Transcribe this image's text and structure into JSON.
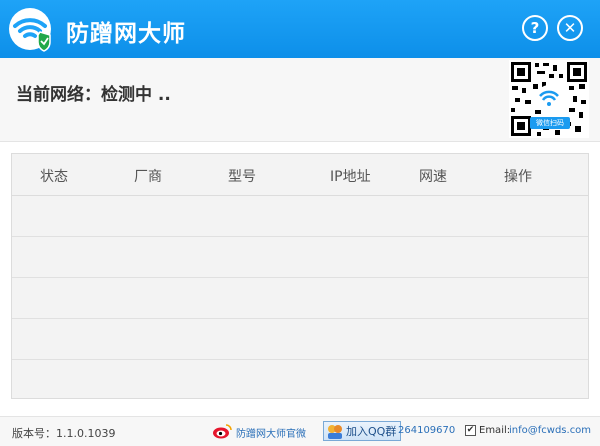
{
  "app": {
    "title": "防蹭网大师",
    "help_symbol": "?",
    "close_symbol": "✕"
  },
  "status": {
    "label": "当前网络：",
    "value": "检测中 .."
  },
  "qr": {
    "caption": "微信扫码"
  },
  "table": {
    "columns": [
      "状态",
      "厂商",
      "型号",
      "IP地址",
      "网速",
      "操作"
    ],
    "rows": [
      [],
      [],
      [],
      [],
      []
    ]
  },
  "footer": {
    "version": "版本号：1.1.0.1039",
    "weibo_text": "防蹭网大师官微",
    "qq_group_label": "加入QQ群",
    "qq_number": "264109670",
    "email_checked_symbol": "✔",
    "email_label": "Email:",
    "email_value": "info@fcwds.com"
  },
  "colors": {
    "titlebar": "#0d8fe9",
    "link": "#2a6fb8"
  }
}
